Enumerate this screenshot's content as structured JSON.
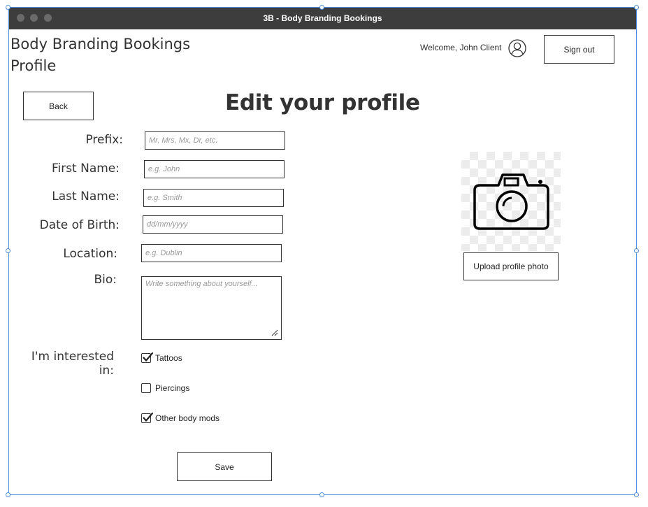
{
  "window": {
    "title": "3B - Body Branding Bookings"
  },
  "header": {
    "app_title_line1": "Body Branding Bookings",
    "app_title_line2": "Profile",
    "welcome": "Welcome, John Client",
    "sign_out_label": "Sign out"
  },
  "page": {
    "back_label": "Back",
    "heading": "Edit your profile",
    "save_label": "Save"
  },
  "form": {
    "prefix": {
      "label": "Prefix:",
      "placeholder": "Mr, Mrs, Mx, Dr, etc."
    },
    "first_name": {
      "label": "First Name:",
      "placeholder": "e.g. John"
    },
    "last_name": {
      "label": "Last Name:",
      "placeholder": "e.g. Smith"
    },
    "dob": {
      "label": "Date of Birth:",
      "placeholder": "dd/mm/yyyy"
    },
    "location": {
      "label": "Location:",
      "placeholder": "e.g. Dublin"
    },
    "bio": {
      "label": "Bio:",
      "placeholder": "Write something about yourself..."
    }
  },
  "interests": {
    "label": "I'm interested in:",
    "options": [
      {
        "label": "Tattoos",
        "checked": true
      },
      {
        "label": "Piercings",
        "checked": false
      },
      {
        "label": "Other body mods",
        "checked": true
      }
    ]
  },
  "photo": {
    "upload_label": "Upload profile photo",
    "icon": "camera-icon"
  }
}
